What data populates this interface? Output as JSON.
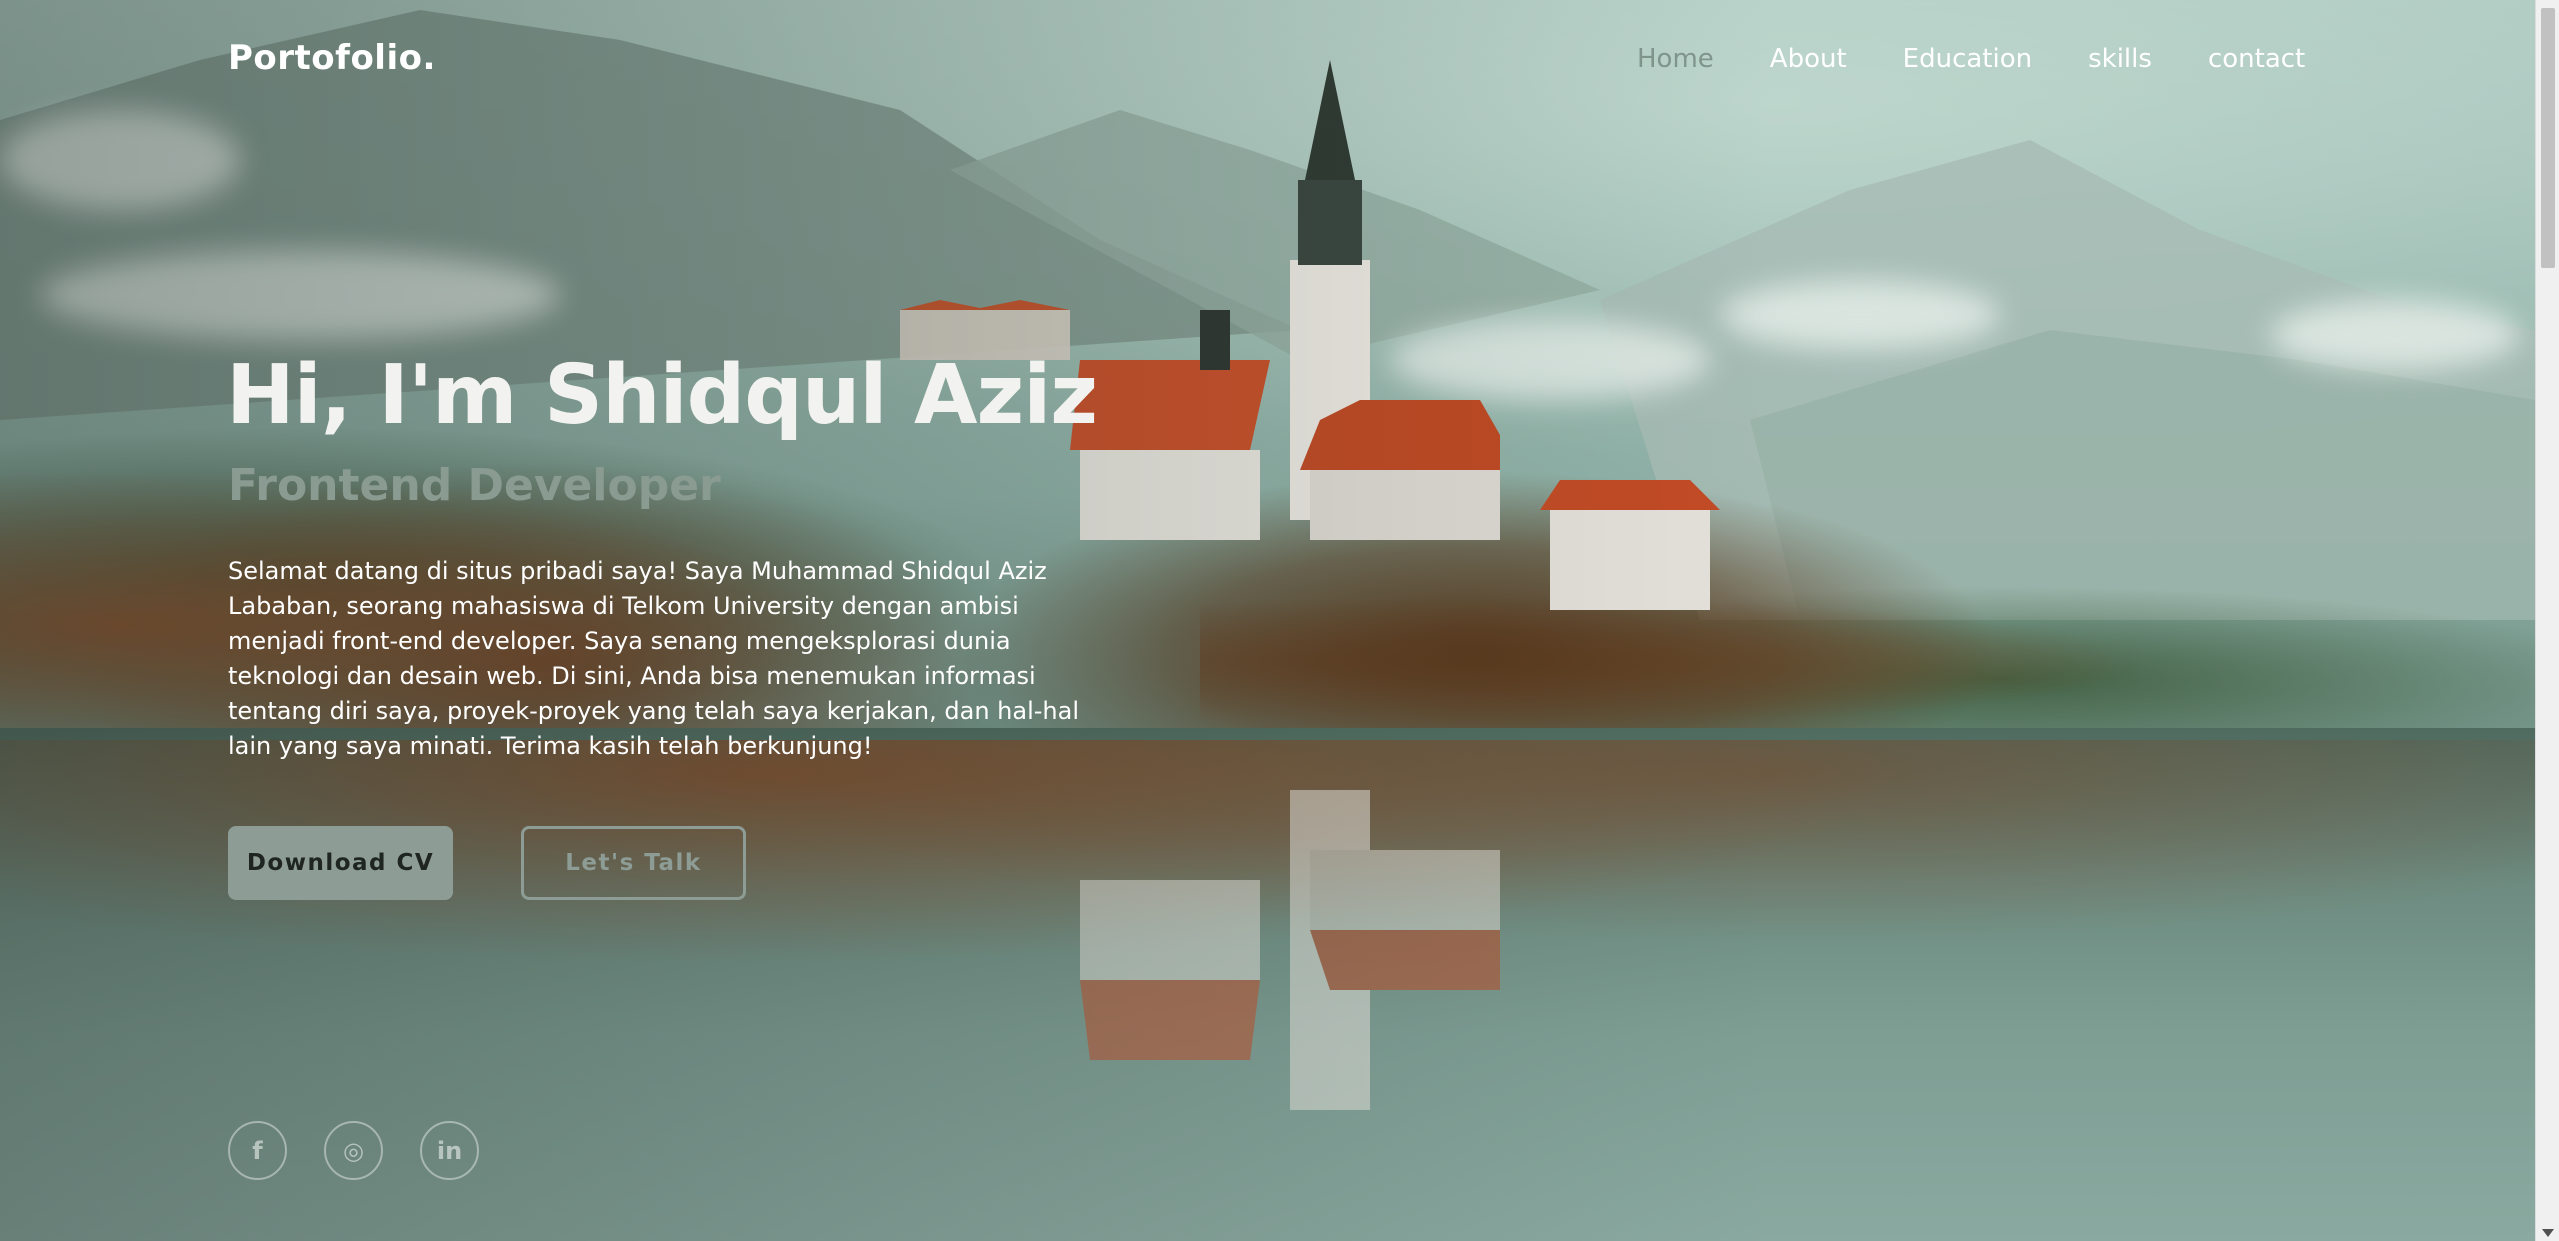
{
  "brand": {
    "logo": "Portofolio."
  },
  "nav": {
    "items": [
      {
        "label": "Home",
        "active": true
      },
      {
        "label": "About",
        "active": false
      },
      {
        "label": "Education",
        "active": false
      },
      {
        "label": "skills",
        "active": false
      },
      {
        "label": "contact",
        "active": false
      }
    ]
  },
  "hero": {
    "title": "Hi, I'm Shidqul Aziz",
    "subtitle": "Frontend Developer",
    "description_lines": [
      "Selamat datang di situs pribadi saya! Saya Muhammad Shidqul Aziz",
      "Lababan, seorang mahasiswa di Telkom University dengan ambisi",
      "menjadi front-end developer. Saya senang mengeksplorasi dunia",
      "teknologi dan desain web. Di sini, Anda bisa menemukan informasi",
      "tentang diri saya, proyek-proyek yang telah saya kerjakan, dan hal-hal",
      "lain yang saya minati. Terima kasih telah berkunjung!"
    ],
    "buttons": {
      "download_cv": "Download CV",
      "lets_talk": "Let's Talk"
    }
  },
  "socials": [
    {
      "icon": "facebook-icon",
      "glyph": "f"
    },
    {
      "icon": "instagram-icon",
      "glyph": "◎"
    },
    {
      "icon": "linkedin-icon",
      "glyph": "in"
    }
  ],
  "colors": {
    "accent": "#8d9c94",
    "nav_active": "#7f958c",
    "text": "#ffffff"
  }
}
